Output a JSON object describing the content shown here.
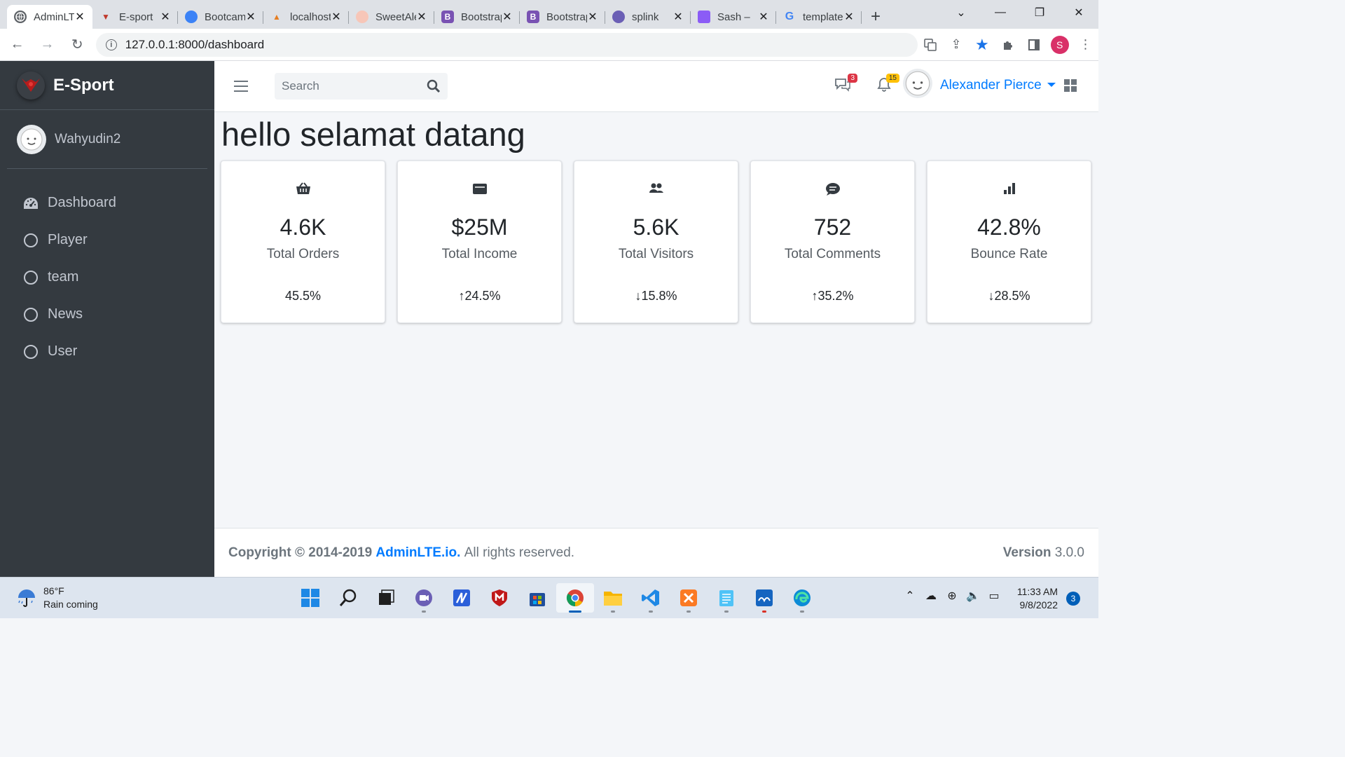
{
  "browser": {
    "tabs": [
      {
        "title": "AdminLTE",
        "favicon": "globe-icon",
        "active": true
      },
      {
        "title": "E-sport",
        "favicon": "esport-logo-icon",
        "active": false
      },
      {
        "title": "Bootcamp",
        "favicon": "bootcamp-icon",
        "active": false
      },
      {
        "title": "localhost",
        "favicon": "phpmyadmin-icon",
        "active": false
      },
      {
        "title": "SweetAlert",
        "favicon": "sweetalert-icon",
        "active": false
      },
      {
        "title": "Bootstrap",
        "favicon": "bootstrap-icon",
        "active": false
      },
      {
        "title": "Bootstrap",
        "favicon": "bootstrap-icon",
        "active": false
      },
      {
        "title": "splink",
        "favicon": "splink-icon",
        "active": false
      },
      {
        "title": "Sash –",
        "favicon": "sash-icon",
        "active": false
      },
      {
        "title": "template",
        "favicon": "google-icon",
        "active": false
      }
    ],
    "url": "127.0.0.1:8000/dashboard",
    "profile_initial": "S"
  },
  "sidebar": {
    "brand": "E-Sport",
    "user": "Wahyudin2",
    "items": [
      {
        "label": "Dashboard",
        "icon": "tachometer-icon"
      },
      {
        "label": "Player",
        "icon": "circle-icon"
      },
      {
        "label": "team",
        "icon": "circle-icon"
      },
      {
        "label": "News",
        "icon": "circle-icon"
      },
      {
        "label": "User",
        "icon": "circle-icon"
      }
    ]
  },
  "navbar": {
    "search_placeholder": "Search",
    "messages_count": "3",
    "notifications_count": "15",
    "user_name": "Alexander Pierce"
  },
  "content": {
    "title": "hello selamat datang",
    "cards": [
      {
        "value": "4.6K",
        "label": "Total Orders",
        "change": "45.5%",
        "direction": "none",
        "icon": "shopping-basket-icon"
      },
      {
        "value": "$25M",
        "label": "Total Income",
        "change": "24.5%",
        "direction": "up",
        "icon": "wallet-icon"
      },
      {
        "value": "5.6K",
        "label": "Total Visitors",
        "change": "15.8%",
        "direction": "down",
        "icon": "users-icon"
      },
      {
        "value": "752",
        "label": "Total Comments",
        "change": "35.2%",
        "direction": "up",
        "icon": "comment-icon"
      },
      {
        "value": "42.8%",
        "label": "Bounce Rate",
        "change": "28.5%",
        "direction": "down",
        "icon": "bar-chart-icon"
      }
    ]
  },
  "footer": {
    "copyright_prefix": "Copyright © 2014-2019",
    "link": "AdminLTE.io.",
    "suffix": "All rights reserved.",
    "version_label": "Version",
    "version": "3.0.0"
  },
  "taskbar": {
    "weather_temp": "86°F",
    "weather_desc": "Rain coming",
    "time": "11:33 AM",
    "date": "9/8/2022",
    "notification_count": "3"
  },
  "colors": {
    "sidebar": "#343a40",
    "accent": "#007bff",
    "badge_red": "#dc3545",
    "badge_yellow": "#ffc107"
  }
}
